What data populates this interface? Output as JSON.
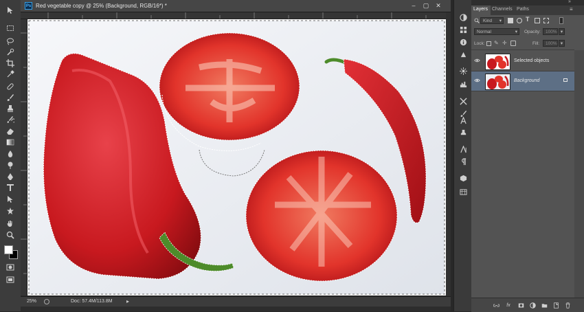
{
  "document": {
    "title": "Red vegetable copy @ 25% (Background, RGB/16*) *",
    "app_badge": "Ps",
    "zoom": "25%",
    "doc_info": "Doc: 57.4M/113.8M"
  },
  "tools": [
    "move-icon",
    "marquee-icon",
    "lasso-icon",
    "quick-select-icon",
    "crop-icon",
    "eyedropper-icon",
    "healing-icon",
    "brush-icon",
    "clone-stamp-icon",
    "history-brush-icon",
    "eraser-icon",
    "gradient-icon",
    "blur-icon",
    "dodge-icon",
    "pen-icon",
    "type-icon",
    "path-select-icon",
    "shape-icon",
    "hand-icon",
    "zoom-icon",
    "foreground-background-icon",
    "quick-mask-icon",
    "screen-mode-icon"
  ],
  "layers_panel": {
    "tabs": [
      "Layers",
      "Channels",
      "Paths"
    ],
    "active_tab": "Layers",
    "filter_kind": "Kind",
    "blend_mode": "Normal",
    "opacity_label": "Opacity:",
    "opacity_value": "100%",
    "lock_label": "Lock:",
    "fill_label": "Fill:",
    "fill_value": "100%",
    "layers": [
      {
        "name": "Selected objects",
        "selected": false,
        "locked": false
      },
      {
        "name": "Background",
        "selected": true,
        "locked": true
      }
    ]
  },
  "colors": {
    "panel_bg": "#535353",
    "selected_layer": "#5d6f85",
    "pepper_red": "#c8191f",
    "tomato_red": "#e2342b",
    "stem_green": "#4d8b2a"
  }
}
